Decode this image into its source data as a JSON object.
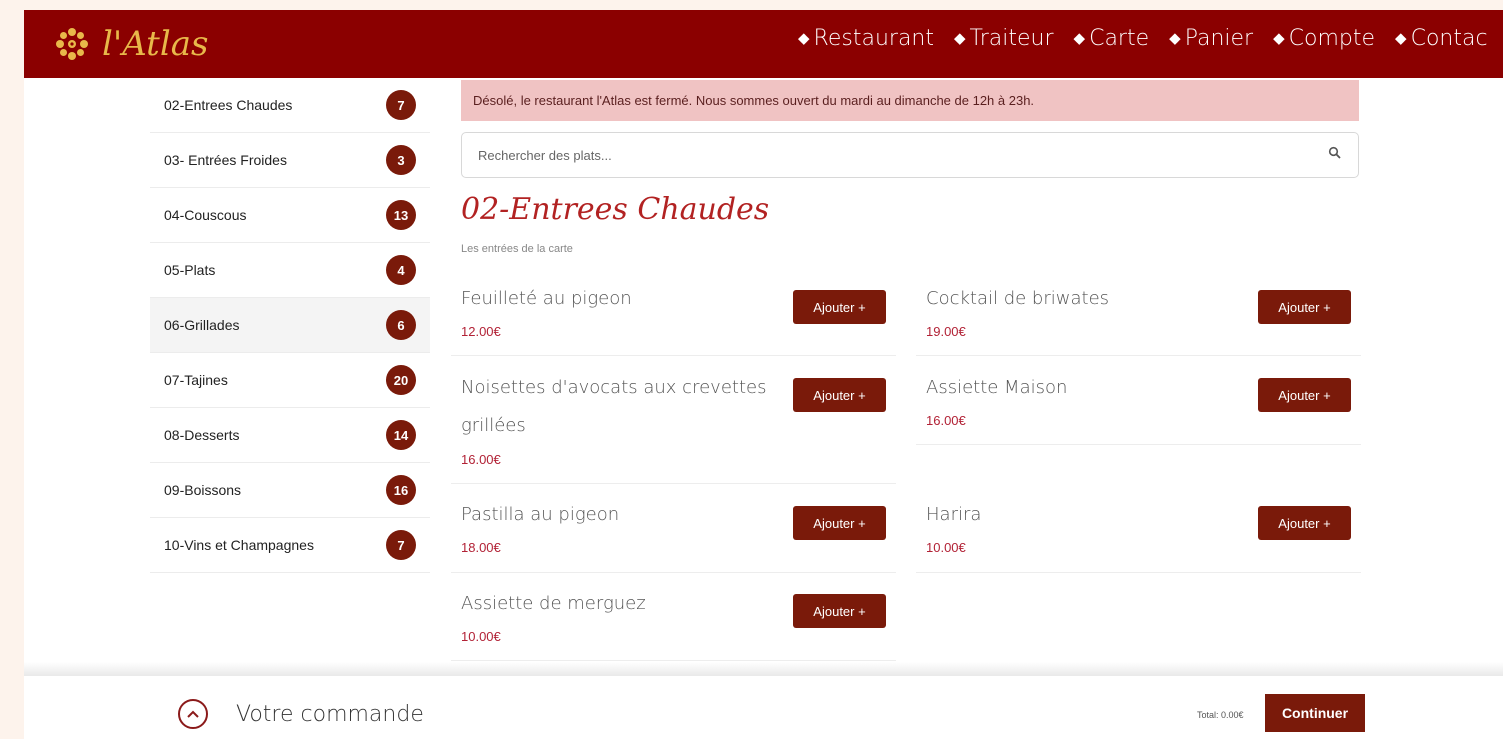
{
  "brand": {
    "logo_text": "l'Atlas"
  },
  "nav": [
    {
      "label": "Restaurant"
    },
    {
      "label": "Traiteur"
    },
    {
      "label": "Carte"
    },
    {
      "label": "Panier"
    },
    {
      "label": "Compte"
    },
    {
      "label": "Contac"
    }
  ],
  "categories": [
    {
      "label": "02-Entrees Chaudes",
      "count": "7"
    },
    {
      "label": "03- Entrées Froides",
      "count": "3"
    },
    {
      "label": "04-Couscous",
      "count": "13"
    },
    {
      "label": "05-Plats",
      "count": "4"
    },
    {
      "label": "06-Grillades",
      "count": "6"
    },
    {
      "label": "07-Tajines",
      "count": "20"
    },
    {
      "label": "08-Desserts",
      "count": "14"
    },
    {
      "label": "09-Boissons",
      "count": "16"
    },
    {
      "label": "10-Vins et Champagnes",
      "count": "7"
    }
  ],
  "alert": "Désolé, le restaurant l'Atlas est fermé. Nous sommes ouvert du mardi au dimanche de 12h à 23h.",
  "search": {
    "placeholder": "Rechercher des plats..."
  },
  "section": {
    "title": "02-Entrees Chaudes",
    "subtitle": "Les entrées de la carte"
  },
  "add_label": "Ajouter +",
  "dishes": [
    {
      "name": "Feuilleté au pigeon",
      "price": "12.00€"
    },
    {
      "name": "Cocktail de briwates",
      "price": "19.00€"
    },
    {
      "name": "Noisettes d'avocats aux crevettes grillées",
      "price": "16.00€"
    },
    {
      "name": "Assiette Maison",
      "price": "16.00€"
    },
    {
      "name": "Pastilla au pigeon",
      "price": "18.00€"
    },
    {
      "name": "Harira",
      "price": "10.00€"
    },
    {
      "name": "Assiette de merguez",
      "price": "10.00€"
    }
  ],
  "footer": {
    "order_label": "Votre commande",
    "total": "Total: 0.00€",
    "continue": "Continuer"
  },
  "colors": {
    "primary": "#8b0000",
    "button": "#7a1a0a",
    "price": "#b22236",
    "alert_bg": "#f0c3c3",
    "logo_gold": "#e8b84a"
  }
}
